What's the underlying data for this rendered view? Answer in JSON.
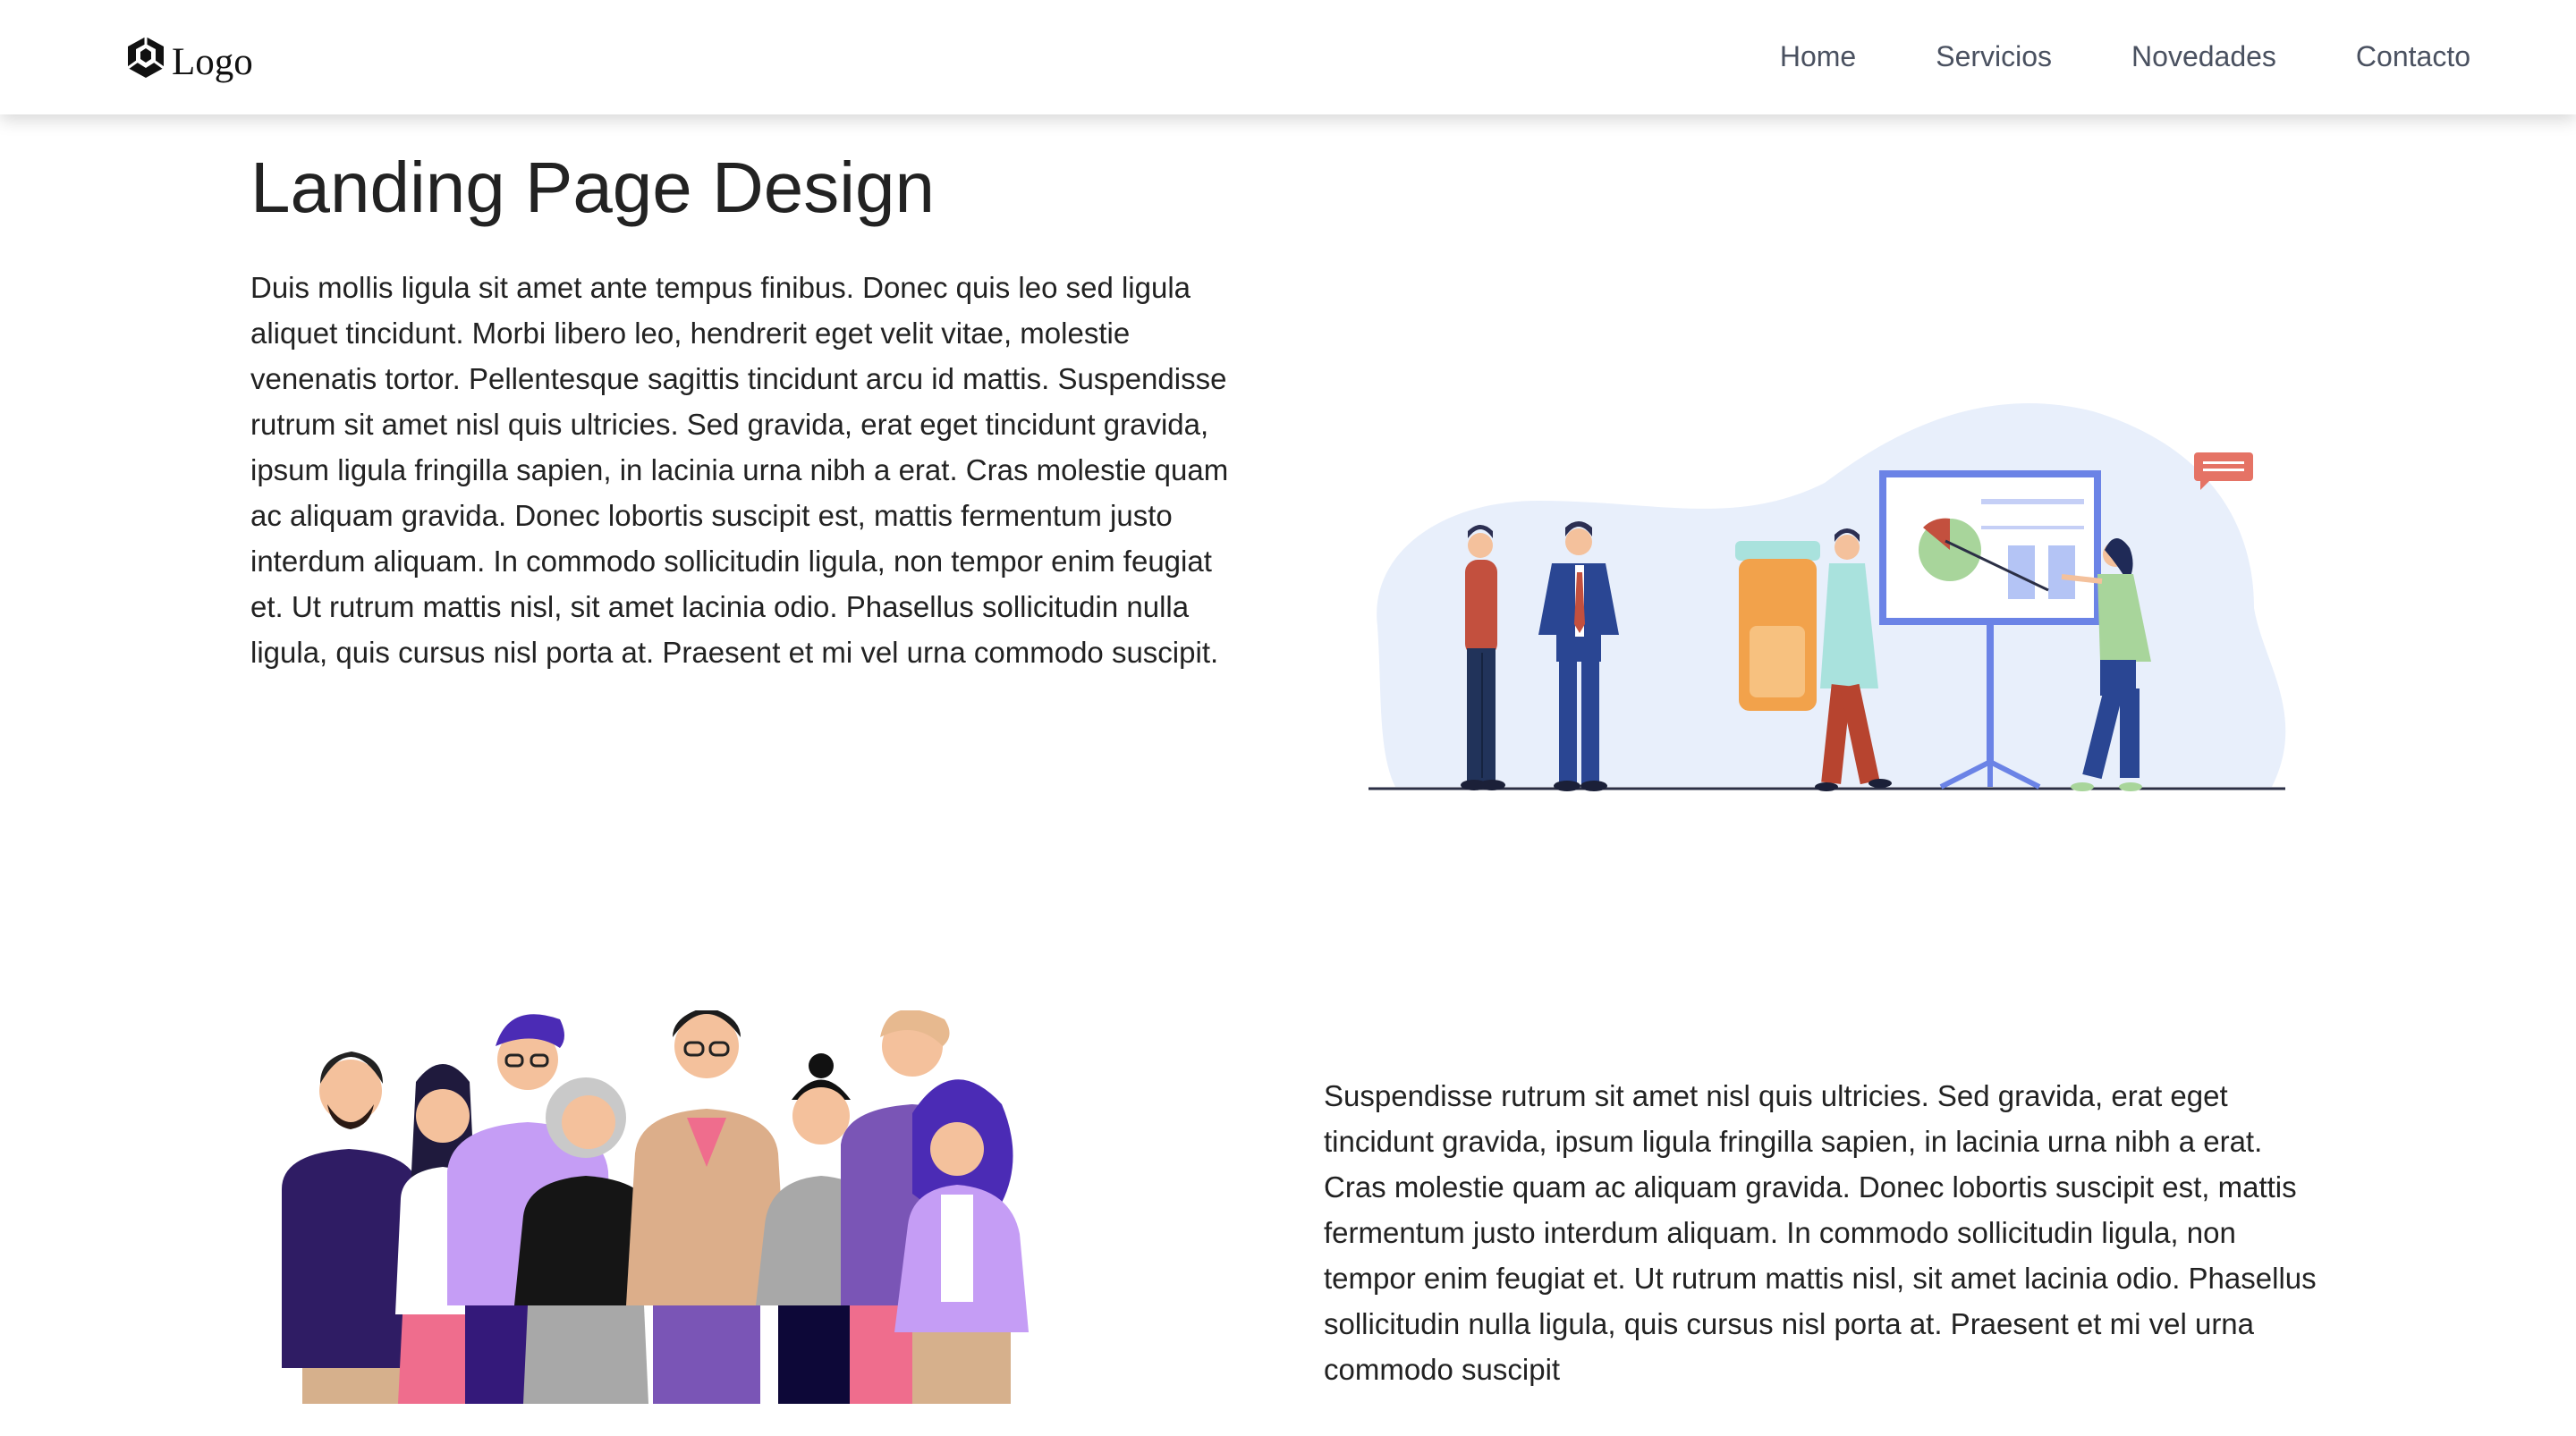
{
  "nav": {
    "logo_text": "Logo",
    "links": [
      "Home",
      "Servicios",
      "Novedades",
      "Contacto"
    ]
  },
  "hero": {
    "title": "Landing Page Design",
    "paragraph": "Duis mollis ligula sit amet ante tempus finibus. Donec quis leo sed ligula aliquet tincidunt. Morbi libero leo, hendrerit eget velit vitae, molestie venenatis tortor. Pellentesque sagittis tincidunt arcu id mattis. Suspendisse rutrum sit amet nisl quis ultricies. Sed gravida, erat eget tincidunt gravida, ipsum ligula fringilla sapien, in lacinia urna nibh a erat. Cras molestie quam ac aliquam gravida. Donec lobortis suscipit est, mattis fermentum justo interdum aliquam. In commodo sollicitudin ligula, non tempor enim feugiat et. Ut rutrum mattis nisl, sit amet lacinia odio. Phasellus sollicitudin nulla ligula, quis cursus nisl porta at. Praesent et mi vel urna commodo suscipit."
  },
  "section2": {
    "paragraph": "Suspendisse rutrum sit amet nisl quis ultricies. Sed gravida, erat eget tincidunt gravida, ipsum ligula fringilla sapien, in lacinia urna nibh a erat. Cras molestie quam ac aliquam gravida. Donec lobortis suscipit est, mattis fermentum justo interdum aliquam. In commodo sollicitudin ligula, non tempor enim feugiat et. Ut rutrum mattis nisl, sit amet lacinia odio. Phasellus sollicitudin nulla ligula, quis cursus nisl porta at. Praesent et mi vel urna commodo suscipit"
  },
  "icons": {
    "logo": "hexagon-blob-logo-icon"
  },
  "colors": {
    "nav_text": "#4a5160",
    "body_text": "#222222",
    "illustration_bg": "#e8effb",
    "board_frame": "#6b83e6"
  }
}
